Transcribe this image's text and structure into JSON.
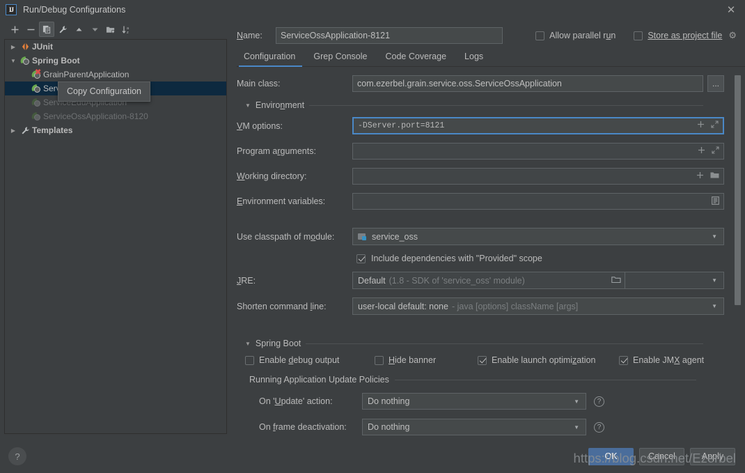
{
  "window": {
    "title": "Run/Debug Configurations",
    "logo_text": "IJ",
    "close_icon": "close-icon"
  },
  "toolbar": {
    "buttons": [
      {
        "name": "add-configuration-button",
        "icon": "plus-icon",
        "glyph": "+"
      },
      {
        "name": "remove-configuration-button",
        "icon": "minus-icon",
        "glyph": "−"
      },
      {
        "name": "copy-configuration-button",
        "icon": "copy-icon",
        "glyph": "❐",
        "active": true
      },
      {
        "name": "edit-templates-button",
        "icon": "wrench-icon",
        "glyph": "🔧"
      },
      {
        "name": "move-up-button",
        "icon": "arrow-up-icon",
        "glyph": "▲"
      },
      {
        "name": "move-down-button",
        "icon": "arrow-down-icon",
        "glyph": "▼"
      },
      {
        "name": "new-folder-button",
        "icon": "folder-plus-icon",
        "glyph": "🗀"
      },
      {
        "name": "sort-configurations-button",
        "icon": "sort-az-icon",
        "glyph": "↓"
      }
    ],
    "tooltip": "Copy Configuration"
  },
  "tree": {
    "items": [
      {
        "label": "JUnit",
        "icon": "junit-icon",
        "level": 0,
        "expandable": true,
        "expanded": false,
        "bold": true,
        "dim": false,
        "selected": false
      },
      {
        "label": "Spring Boot",
        "icon": "spring-boot-icon",
        "level": 0,
        "expandable": true,
        "expanded": true,
        "bold": true,
        "dim": false,
        "selected": false
      },
      {
        "label": "GrainParentApplication",
        "icon": "spring-boot-error-icon",
        "level": 1,
        "expandable": false,
        "expanded": false,
        "bold": false,
        "dim": false,
        "selected": false
      },
      {
        "label": "ServiceOssApplication-8121",
        "icon": "spring-boot-icon",
        "level": 1,
        "expandable": false,
        "expanded": false,
        "bold": false,
        "dim": false,
        "selected": true
      },
      {
        "label": "ServiceEduApplication",
        "icon": "spring-boot-icon",
        "level": 1,
        "expandable": false,
        "expanded": false,
        "bold": false,
        "dim": true,
        "selected": false
      },
      {
        "label": "ServiceOssApplication-8120",
        "icon": "spring-boot-icon",
        "level": 1,
        "expandable": false,
        "expanded": false,
        "bold": false,
        "dim": true,
        "selected": false
      },
      {
        "label": "Templates",
        "icon": "wrench-icon",
        "level": 0,
        "expandable": true,
        "expanded": false,
        "bold": true,
        "dim": false,
        "selected": false
      }
    ]
  },
  "form": {
    "name_label": "Name:",
    "name_value": "ServiceOssApplication-8121",
    "allow_parallel_run": {
      "label": "Allow parallel run",
      "checked": false
    },
    "store_as_project_file": {
      "label": "Store as project file",
      "checked": false
    },
    "gear_icon": "gear-icon",
    "tabs": [
      {
        "label": "Configuration",
        "active": true
      },
      {
        "label": "Grep Console",
        "active": false
      },
      {
        "label": "Code Coverage",
        "active": false
      },
      {
        "label": "Logs",
        "active": false
      }
    ],
    "main_class": {
      "label": "Main class:",
      "value": "com.ezerbel.grain.service.oss.ServiceOssApplication",
      "browse_label": "..."
    },
    "environment_section": "Environment",
    "vm_options": {
      "label": "VM options:",
      "value": "-DServer.port=8121",
      "focused": true,
      "actions": [
        "plus-icon",
        "expand-icon"
      ]
    },
    "program_arguments": {
      "label": "Program arguments:",
      "value": "",
      "actions": [
        "plus-icon",
        "expand-icon"
      ]
    },
    "working_directory": {
      "label": "Working directory:",
      "value": "",
      "actions": [
        "plus-icon",
        "folder-icon"
      ]
    },
    "environment_variables": {
      "label": "Environment variables:",
      "value": "",
      "actions": [
        "list-icon"
      ]
    },
    "classpath_module": {
      "label": "Use classpath of module:",
      "value": "service_oss",
      "icon": "module-icon"
    },
    "include_provided": {
      "label": "Include dependencies with \"Provided\" scope",
      "checked": true
    },
    "jre": {
      "label": "JRE:",
      "value": "Default",
      "hint": "(1.8 - SDK of 'service_oss' module)"
    },
    "shorten_command_line": {
      "label": "Shorten command line:",
      "value": "user-local default: none",
      "hint": "- java [options] className [args]"
    },
    "spring_boot_section": "Spring Boot",
    "spring_boot_checks": [
      {
        "label": "Enable debug output",
        "checked": false
      },
      {
        "label": "Hide banner",
        "checked": false
      },
      {
        "label": "Enable launch optimization",
        "checked": true
      },
      {
        "label": "Enable JMX agent",
        "checked": true
      }
    ],
    "policies_title": "Running Application Update Policies",
    "policies": [
      {
        "label": "On 'Update' action:",
        "value": "Do nothing",
        "help_icon": "help-icon"
      },
      {
        "label": "On frame deactivation:",
        "value": "Do nothing",
        "help_icon": "help-icon"
      }
    ]
  },
  "footer": {
    "help_label": "?",
    "buttons": [
      {
        "label": "OK",
        "primary": true
      },
      {
        "label": "Cancel",
        "primary": false
      },
      {
        "label": "Apply",
        "primary": false
      }
    ],
    "watermark": "https://blog.csdn.net/Ezerbel"
  },
  "colors": {
    "background": "#3c3f41",
    "accent": "#4a88c7",
    "selection": "#0d293f",
    "field": "#45494a",
    "primary_button": "#4a6d9b",
    "text": "#bbbbbb",
    "dim_text": "#6e7173"
  }
}
